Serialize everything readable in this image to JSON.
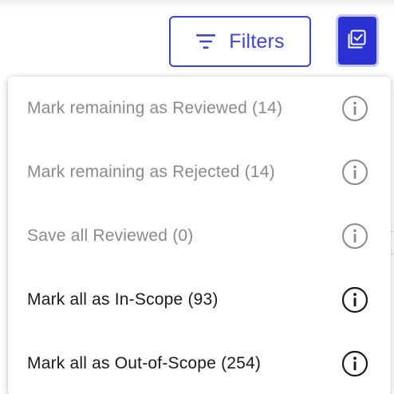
{
  "header": {
    "filters_label": "Filters",
    "filters_icon": "filter-lines-icon",
    "bulk_icon": "checkbox-stack-icon"
  },
  "menu": {
    "items": [
      {
        "label": "Mark remaining as Reviewed (14)",
        "state": "disabled",
        "icon": "info-icon"
      },
      {
        "label": "Mark remaining as Rejected (14)",
        "state": "disabled",
        "icon": "info-icon"
      },
      {
        "label": "Save all Reviewed (0)",
        "state": "disabled",
        "icon": "info-icon"
      },
      {
        "label": "Mark all as In-Scope (93)",
        "state": "enabled",
        "icon": "info-icon"
      },
      {
        "label": "Mark all as Out-of-Scope (254)",
        "state": "enabled",
        "icon": "info-icon"
      }
    ]
  },
  "colors": {
    "accent": "#3d45cc",
    "accent_fill": "#2a32d4",
    "disabled_text": "#8a8a8a",
    "enabled_text": "#1a1a1a"
  }
}
